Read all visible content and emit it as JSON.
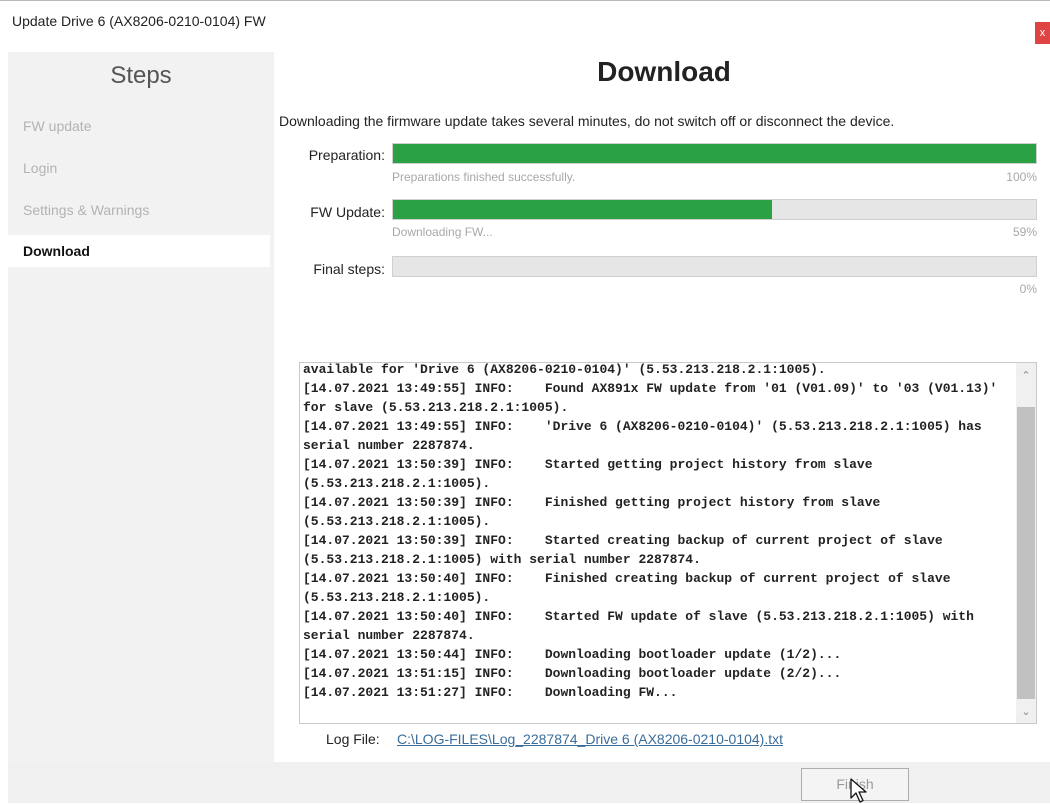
{
  "window": {
    "title": "Update Drive 6 (AX8206-0210-0104) FW",
    "close_label": "x"
  },
  "sidebar": {
    "title": "Steps",
    "items": [
      {
        "label": "FW update",
        "state": "done"
      },
      {
        "label": "Login",
        "state": "done"
      },
      {
        "label": "Settings & Warnings",
        "state": "done"
      },
      {
        "label": "Download",
        "state": "active"
      }
    ]
  },
  "main": {
    "title": "Download",
    "description": "Downloading the firmware update takes several minutes, do not switch off or disconnect the device.",
    "progress": [
      {
        "label": "Preparation:",
        "status": "Preparations finished successfully.",
        "percent_text": "100%",
        "value": 1.0
      },
      {
        "label": "FW Update:",
        "status": "Downloading FW...",
        "percent_text": "59%",
        "value": 0.59
      },
      {
        "label": "Final steps:",
        "status": "",
        "percent_text": "0%",
        "value": 0.0
      }
    ],
    "log_lines": [
      "available for 'Drive 6 (AX8206-0210-0104)' (5.53.213.218.2.1:1005).",
      "[14.07.2021 13:49:55] INFO:    Found AX891x FW update from '01 (V01.09)' to '03 (V01.13)' for slave (5.53.213.218.2.1:1005).",
      "[14.07.2021 13:49:55] INFO:    'Drive 6 (AX8206-0210-0104)' (5.53.213.218.2.1:1005) has serial number 2287874.",
      "[14.07.2021 13:50:39] INFO:    Started getting project history from slave (5.53.213.218.2.1:1005).",
      "[14.07.2021 13:50:39] INFO:    Finished getting project history from slave (5.53.213.218.2.1:1005).",
      "[14.07.2021 13:50:39] INFO:    Started creating backup of current project of slave (5.53.213.218.2.1:1005) with serial number 2287874.",
      "[14.07.2021 13:50:40] INFO:    Finished creating backup of current project of slave (5.53.213.218.2.1:1005).",
      "[14.07.2021 13:50:40] INFO:    Started FW update of slave (5.53.213.218.2.1:1005) with serial number 2287874.",
      "[14.07.2021 13:50:44] INFO:    Downloading bootloader update (1/2)...",
      "[14.07.2021 13:51:15] INFO:    Downloading bootloader update (2/2)...",
      "[14.07.2021 13:51:27] INFO:    Downloading FW..."
    ],
    "log_file_label": "Log File:",
    "log_file_path": "C:\\LOG-FILES\\Log_2287874_Drive 6 (AX8206-0210-0104).txt"
  },
  "footer": {
    "finish_label": "Finish"
  },
  "colors": {
    "progress_fill": "#2aa144",
    "close_button": "#e04343",
    "link": "#3a6d9a"
  }
}
